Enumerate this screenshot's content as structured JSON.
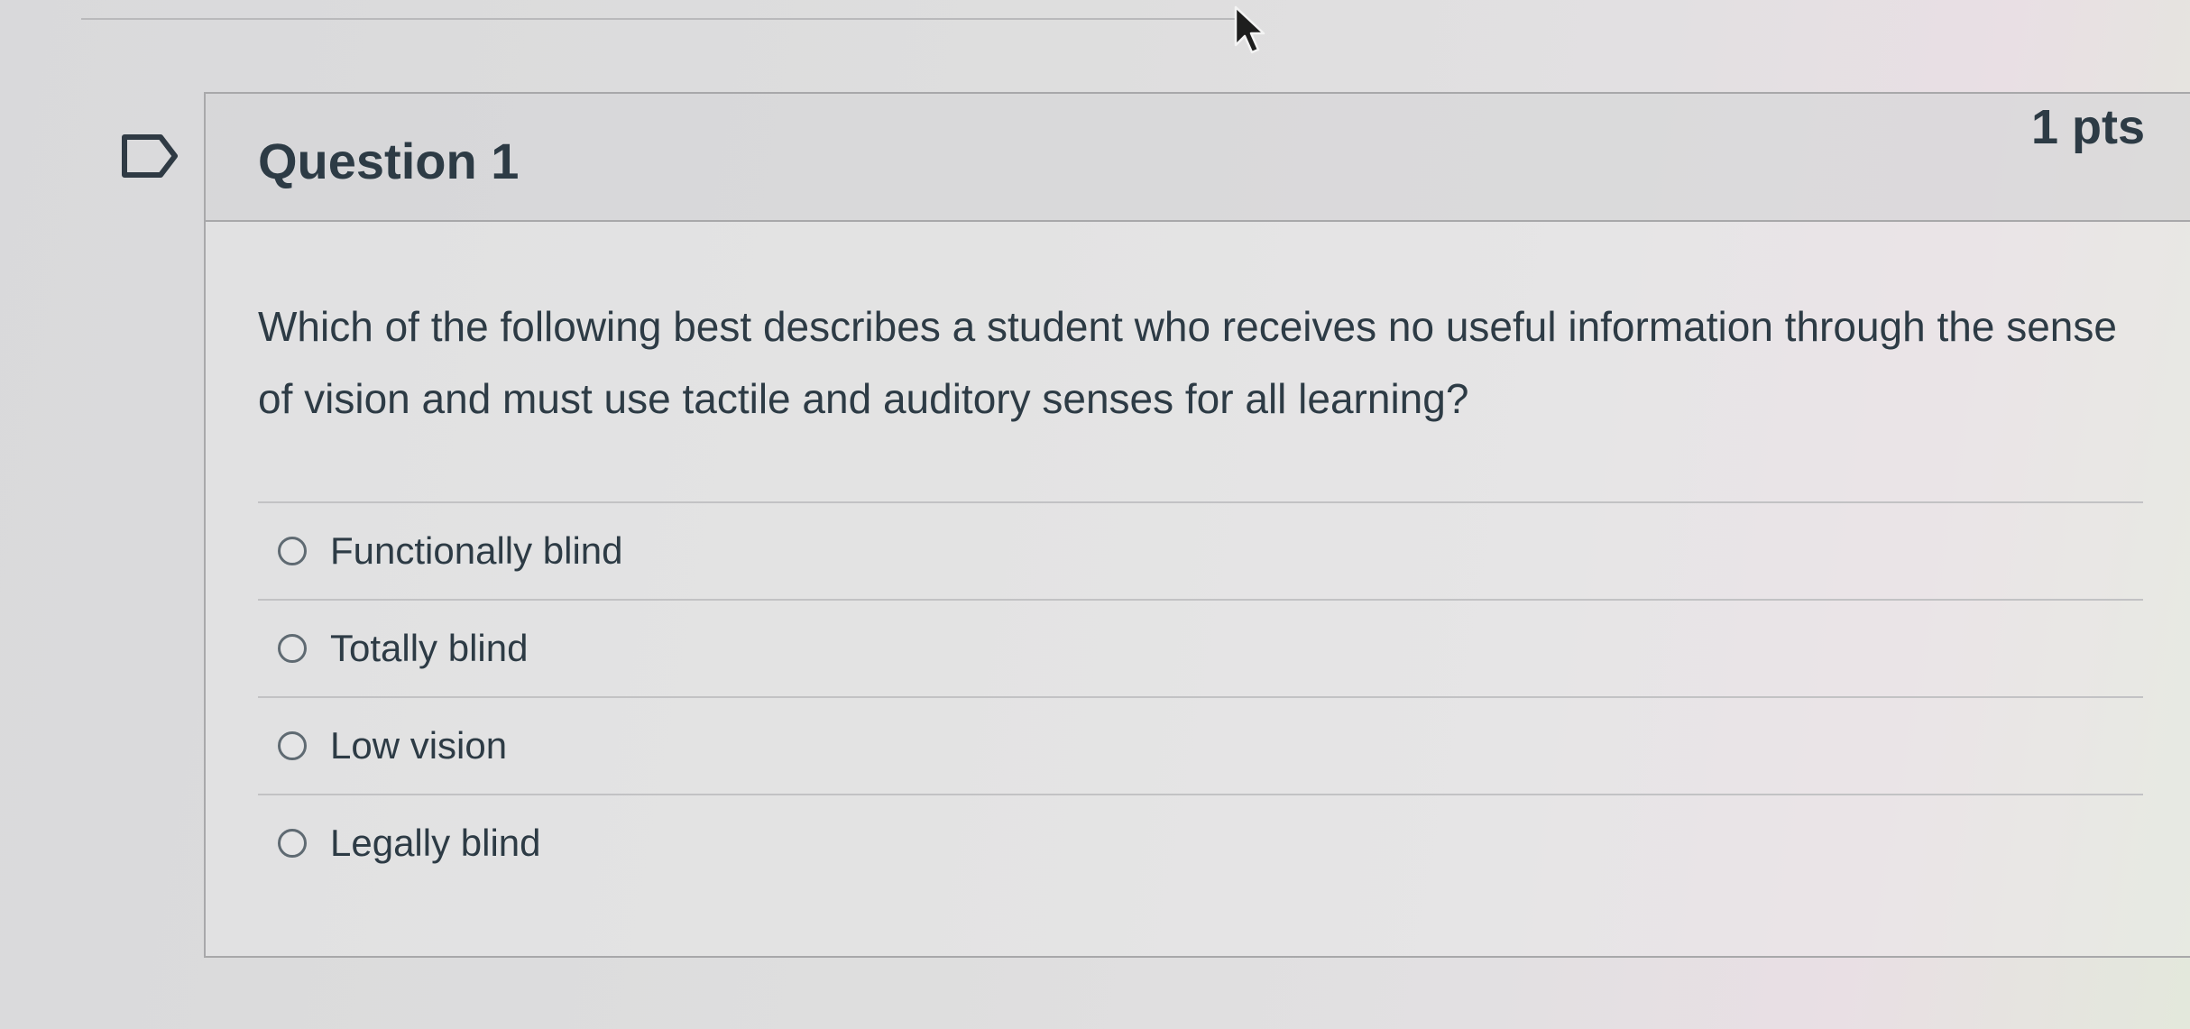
{
  "question": {
    "title": "Question 1",
    "points": "1 pts",
    "text": "Which of the following best describes a student who receives no useful information through the sense of vision and must use tactile and auditory senses for all learning?",
    "answers": [
      {
        "label": "Functionally blind",
        "selected": false
      },
      {
        "label": "Totally blind",
        "selected": false
      },
      {
        "label": "Low vision",
        "selected": false
      },
      {
        "label": "Legally blind",
        "selected": false
      }
    ]
  },
  "icons": {
    "flag": "bookmark-flag-icon",
    "cursor": "mouse-pointer-icon",
    "radio": "radio-button-icon"
  },
  "colors": {
    "text": "#2d3b45",
    "border": "#a8a8aa",
    "radio": "#5f6a72"
  }
}
